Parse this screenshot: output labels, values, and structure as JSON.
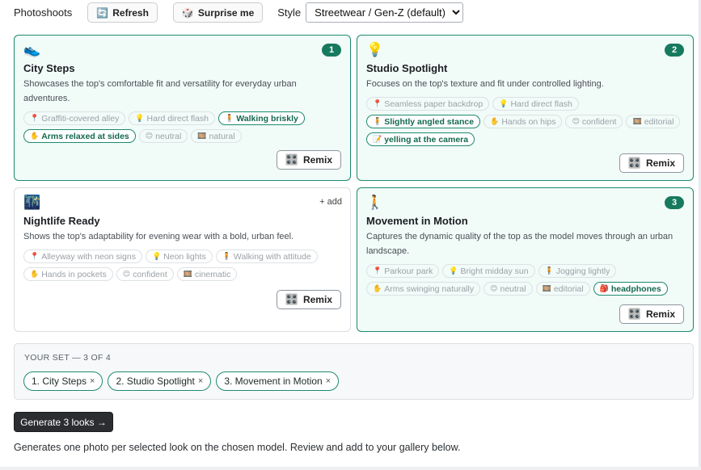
{
  "toolbar": {
    "section_label": "Photoshoots",
    "refresh": {
      "icon": "🔄",
      "label": "Refresh"
    },
    "surprise": {
      "icon": "🎲",
      "label": "Surprise me"
    },
    "style_label": "Style",
    "style_selected": "Streetwear / Gen-Z (default)"
  },
  "cards": [
    {
      "emoji": "👟",
      "badge": "1",
      "title": "City Steps",
      "description": "Showcases the top's comfortable fit and versatility for everyday urban adventures.",
      "chips": [
        {
          "icon": "📍",
          "label": "Graffiti-covered alley"
        },
        {
          "icon": "💡",
          "label": "Hard direct flash"
        },
        {
          "icon": "🧍",
          "label": "Walking briskly"
        },
        {
          "icon": "✋",
          "label": "Arms relaxed at sides"
        },
        {
          "icon": "😊",
          "label": "neutral"
        },
        {
          "icon": "🎞️",
          "label": "natural"
        }
      ],
      "remix": "Remix"
    },
    {
      "emoji": "💡",
      "badge": "2",
      "title": "Studio Spotlight",
      "description": "Focuses on the top's texture and fit under controlled lighting.",
      "chips": [
        {
          "icon": "📍",
          "label": "Seamless paper backdrop"
        },
        {
          "icon": "💡",
          "label": "Hard direct flash"
        },
        {
          "icon": "🧍",
          "label": "Slightly angled stance"
        },
        {
          "icon": "✋",
          "label": "Hands on hips"
        },
        {
          "icon": "😊",
          "label": "confident"
        },
        {
          "icon": "🎞️",
          "label": "editorial"
        },
        {
          "icon": "📝",
          "label": "yelling at the camera"
        }
      ],
      "remix": "Remix"
    },
    {
      "emoji": "🌃",
      "add_label": "+ add",
      "title": "Nightlife Ready",
      "description": "Shows the top's adaptability for evening wear with a bold, urban feel.",
      "chips": [
        {
          "icon": "📍",
          "label": "Alleyway with neon signs"
        },
        {
          "icon": "💡",
          "label": "Neon lights"
        },
        {
          "icon": "🧍",
          "label": "Walking with attitude"
        },
        {
          "icon": "✋",
          "label": "Hands in pockets"
        },
        {
          "icon": "😊",
          "label": "confident"
        },
        {
          "icon": "🎞️",
          "label": "cinematic"
        }
      ],
      "remix": "Remix"
    },
    {
      "emoji": "🚶",
      "badge": "3",
      "title": "Movement in Motion",
      "description": "Captures the dynamic quality of the top as the model moves through an urban landscape.",
      "chips": [
        {
          "icon": "📍",
          "label": "Parkour park"
        },
        {
          "icon": "💡",
          "label": "Bright midday sun"
        },
        {
          "icon": "🧍",
          "label": "Jogging lightly"
        },
        {
          "icon": "✋",
          "label": "Arms swinging naturally"
        },
        {
          "icon": "😊",
          "label": "neutral"
        },
        {
          "icon": "🎞️",
          "label": "editorial"
        },
        {
          "icon": "🎒",
          "label": "headphones"
        }
      ],
      "remix": "Remix"
    }
  ],
  "set": {
    "heading": "YOUR SET — 3 OF 4",
    "items": [
      "1. City Steps",
      "2. Studio Spotlight",
      "3. Movement in Motion"
    ],
    "remove_glyph": "×"
  },
  "generate_label": "Generate 3 looks →",
  "help_text": "Generates one photo per selected look on the chosen model. Review and add to your gallery below.",
  "colors": {
    "accent": "#1d8a6e",
    "selected_bg": "#f1fbf8",
    "badge": "#167a5e",
    "dark_button": "#2b2d30"
  }
}
